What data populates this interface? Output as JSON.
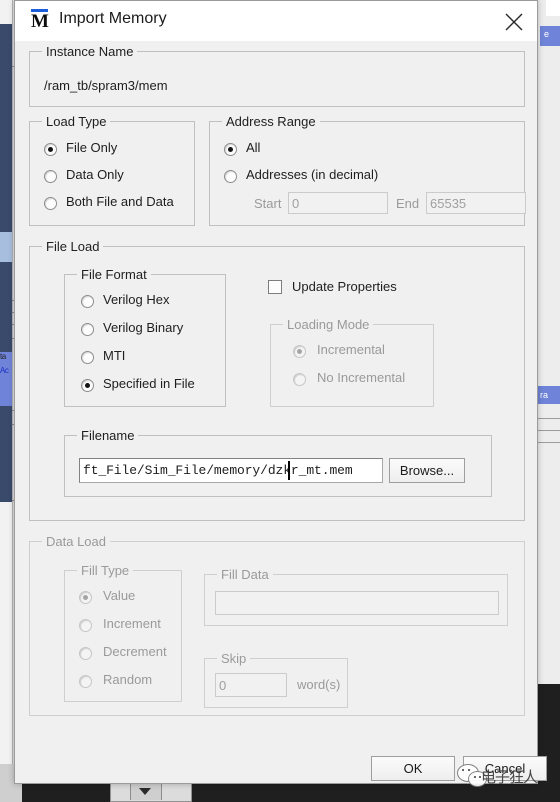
{
  "window": {
    "title": "Import Memory",
    "app_icon": "modelsim-m-icon",
    "close_icon": "close-icon"
  },
  "instance_name": {
    "legend": "Instance Name",
    "value": "/ram_tb/spram3/mem"
  },
  "load_type": {
    "legend": "Load Type",
    "options": [
      {
        "label": "File Only",
        "selected": true
      },
      {
        "label": "Data Only",
        "selected": false
      },
      {
        "label": "Both File and Data",
        "selected": false
      }
    ]
  },
  "address_range": {
    "legend": "Address Range",
    "options": [
      {
        "label": "All",
        "selected": true
      },
      {
        "label": "Addresses (in decimal)",
        "selected": false
      }
    ],
    "start_label": "Start",
    "start_value": "0",
    "end_label": "End",
    "end_value": "65535"
  },
  "file_load": {
    "legend": "File Load",
    "file_format": {
      "legend": "File Format",
      "options": [
        {
          "label": "Verilog Hex",
          "selected": false
        },
        {
          "label": "Verilog Binary",
          "selected": false
        },
        {
          "label": "MTI",
          "selected": false
        },
        {
          "label": "Specified in File",
          "selected": true
        }
      ]
    },
    "update_properties": {
      "label": "Update Properties",
      "checked": false
    },
    "loading_mode": {
      "legend": "Loading Mode",
      "enabled": false,
      "options": [
        {
          "label": "Incremental",
          "selected": true
        },
        {
          "label": "No Incremental",
          "selected": false
        }
      ]
    },
    "filename": {
      "legend": "Filename",
      "value": "ft_File/Sim_File/memory/dzkr_mt.mem",
      "browse_label": "Browse..."
    }
  },
  "data_load": {
    "legend": "Data Load",
    "enabled": false,
    "fill_type": {
      "legend": "Fill Type",
      "options": [
        {
          "label": "Value",
          "selected": true
        },
        {
          "label": "Increment",
          "selected": false
        },
        {
          "label": "Decrement",
          "selected": false
        },
        {
          "label": "Random",
          "selected": false
        }
      ]
    },
    "fill_data": {
      "legend": "Fill Data",
      "value": ""
    },
    "skip": {
      "legend": "Skip",
      "value": "0",
      "units_label": "word(s)"
    }
  },
  "footer": {
    "ok_label": "OK",
    "cancel_label": "Cancel"
  },
  "watermark": {
    "text": "电子狂人",
    "icon": "wechat-icon"
  },
  "background": {
    "left_labels": [
      "ta",
      "Ac"
    ],
    "right_label": "ra",
    "right_top_label": "e"
  },
  "colors": {
    "dialog_bg": "#f0f0f0",
    "titlebar_bg": "#ffffff",
    "group_border": "#c0c0c0",
    "accent_blue": "#1b5ddb",
    "selection_blue": "#6f84d8",
    "text": "#1e1e1e",
    "disabled_text": "#9a9a9a"
  }
}
